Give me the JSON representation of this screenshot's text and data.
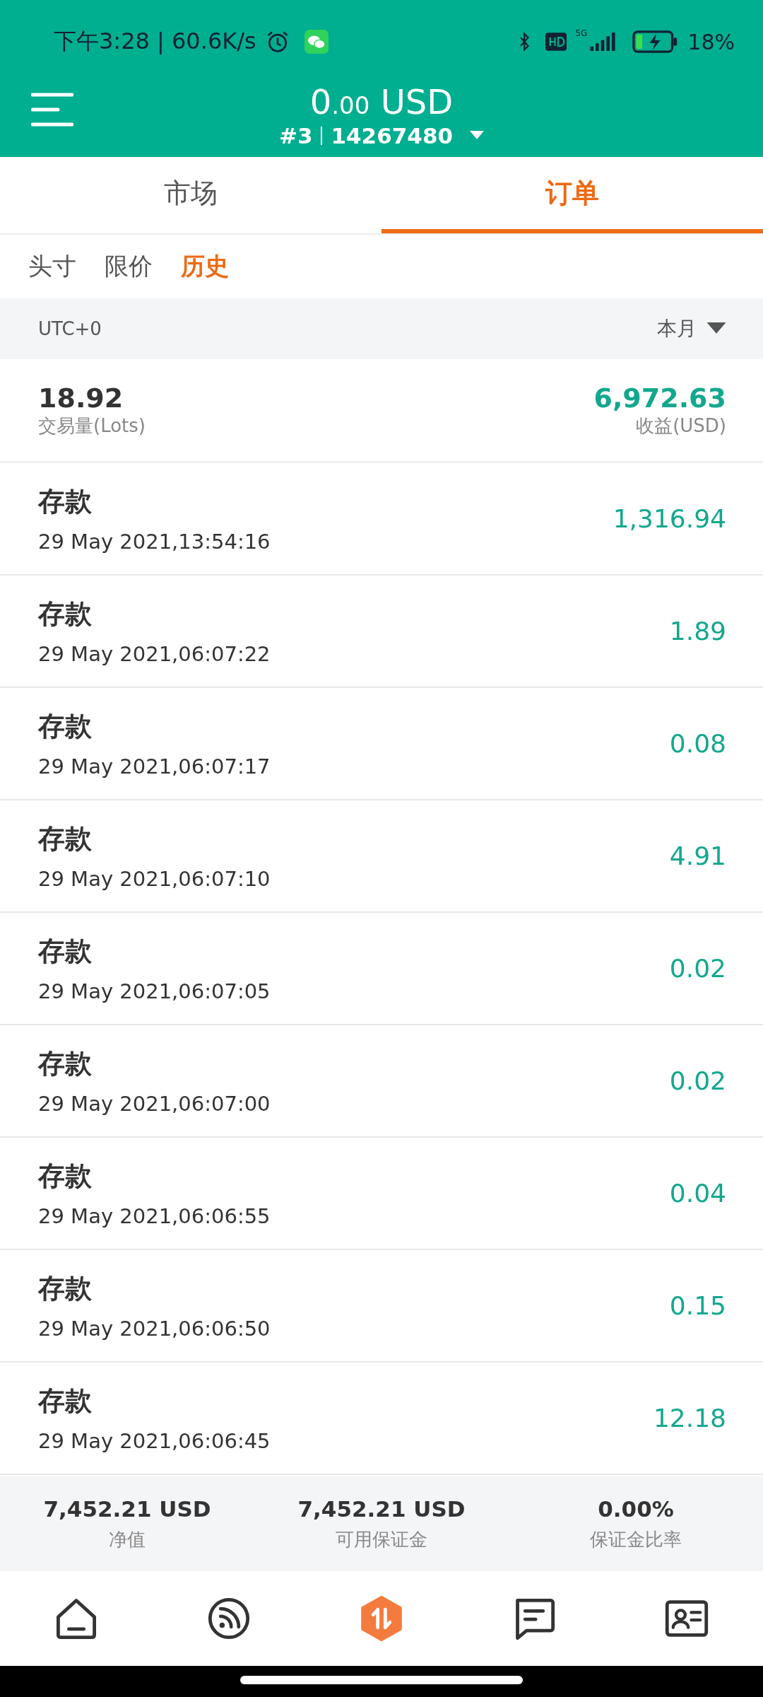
{
  "status_bar": {
    "time": "下午3:28 | 60.6K/s",
    "network": "5G",
    "battery_percent": "18%"
  },
  "header": {
    "balance": {
      "whole": "0",
      "fraction": ".00",
      "currency": "USD"
    },
    "account_index": "#3",
    "account_number": "14267480"
  },
  "tabs": [
    {
      "label": "市场",
      "selected": false
    },
    {
      "label": "订单",
      "selected": true
    }
  ],
  "sub_tabs": [
    {
      "label": "头寸",
      "selected": false
    },
    {
      "label": "限价",
      "selected": false
    },
    {
      "label": "历史",
      "selected": true
    }
  ],
  "filter_bar": {
    "timezone": "UTC+0",
    "period": "本月"
  },
  "summary": {
    "volume": "18.92",
    "volume_label": "交易量(Lots)",
    "profit": "6,972.63",
    "profit_label": "收益(USD)"
  },
  "transactions": [
    {
      "type": "存款",
      "time": "29 May 2021,13:54:16",
      "amount": "1,316.94"
    },
    {
      "type": "存款",
      "time": "29 May 2021,06:07:22",
      "amount": "1.89"
    },
    {
      "type": "存款",
      "time": "29 May 2021,06:07:17",
      "amount": "0.08"
    },
    {
      "type": "存款",
      "time": "29 May 2021,06:07:10",
      "amount": "4.91"
    },
    {
      "type": "存款",
      "time": "29 May 2021,06:07:05",
      "amount": "0.02"
    },
    {
      "type": "存款",
      "time": "29 May 2021,06:07:00",
      "amount": "0.02"
    },
    {
      "type": "存款",
      "time": "29 May 2021,06:06:55",
      "amount": "0.04"
    },
    {
      "type": "存款",
      "time": "29 May 2021,06:06:50",
      "amount": "0.15"
    },
    {
      "type": "存款",
      "time": "29 May 2021,06:06:45",
      "amount": "12.18"
    }
  ],
  "account_summary": [
    {
      "value": "7,452.21 USD",
      "label": "净值"
    },
    {
      "value": "7,452.21 USD",
      "label": "可用保证金"
    },
    {
      "value": "0.00%",
      "label": "保证金比率"
    }
  ],
  "bottom_nav": [
    {
      "kind": "home",
      "selected": false
    },
    {
      "kind": "feed",
      "selected": false
    },
    {
      "kind": "trade",
      "selected": true
    },
    {
      "kind": "chat",
      "selected": false
    },
    {
      "kind": "profile",
      "selected": false
    }
  ]
}
